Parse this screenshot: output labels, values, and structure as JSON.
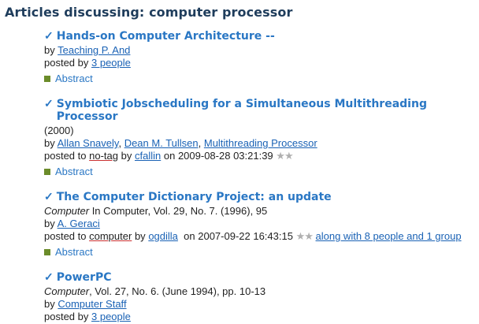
{
  "heading": "Articles discussing: computer processor",
  "check_glyph": "✓",
  "articles": [
    {
      "title": "Hands-on Computer Architecture --",
      "by_label": "by",
      "authors": [
        "Teaching P. And"
      ],
      "posted_by_label": "posted by",
      "people": "3 people",
      "abstract": "Abstract"
    },
    {
      "title": "Symbiotic Jobscheduling for a Simultaneous Multithreading Processor",
      "year": "(2000)",
      "by_label": "by",
      "authors": [
        "Allan Snavely",
        "Dean M. Tullsen",
        "Multithreading Processor"
      ],
      "posted_to_label": "posted to",
      "tag": "no-tag",
      "by2": "by",
      "user": "cfallin",
      "on_label": "on",
      "date": "2009-08-28 03:21:39",
      "stars": "★★",
      "abstract": "Abstract"
    },
    {
      "title": "The Computer Dictionary Project: an update",
      "source_italic": "Computer",
      "source_rest": " In Computer, Vol. 29, No. 7. (1996), 95",
      "by_label": "by",
      "authors": [
        "A. Geraci"
      ],
      "posted_to_label": "posted to",
      "tag": "computer",
      "by2": "by",
      "user": "ogdilla",
      "on_label": "on",
      "date": "2007-09-22 16:43:15",
      "stars": "★★",
      "along_with": "along with 8 people and 1 group",
      "abstract": "Abstract"
    },
    {
      "title": "PowerPC",
      "source_italic": "Computer",
      "source_rest": ", Vol. 27, No. 6. (June 1994), pp. 10-13",
      "by_label": "by",
      "authors": [
        "Computer Staff"
      ],
      "posted_by_label": "posted by",
      "people": "3 people"
    }
  ],
  "colors": {
    "heading": "#1f3d5c",
    "title": "#2a77c4",
    "link": "#1a62b5",
    "tag_underline": "#c83030",
    "abstract_bullet": "#6b8c2a",
    "stars": "#b0b0b0"
  },
  "icons": {
    "check": "check-icon",
    "abstract": "abstract-bullet-icon",
    "stars": "star-icon"
  }
}
